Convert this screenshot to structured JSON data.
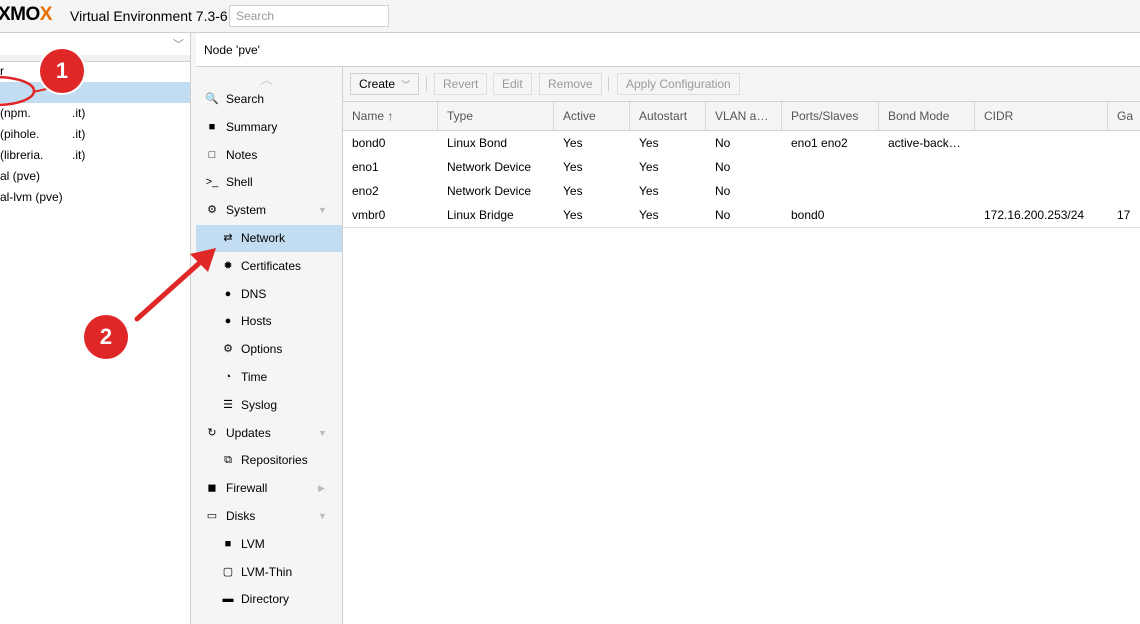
{
  "header": {
    "logo": "XMOX",
    "version": "Virtual Environment 7.3-6",
    "search_placeholder": "Search"
  },
  "tree": {
    "rows": [
      {
        "text": "r",
        "host": ""
      },
      {
        "text": "",
        "host": "",
        "selected": true
      },
      {
        "text": "(npm.",
        "host": ".it)"
      },
      {
        "text": "(pihole.",
        "host": ".it)"
      },
      {
        "text": "(libreria.",
        "host": ".it)"
      },
      {
        "text": "al (pve)",
        "host": ""
      },
      {
        "text": "al-lvm (pve)",
        "host": ""
      }
    ]
  },
  "node_title": "Node 'pve'",
  "menu": [
    {
      "label": "Search",
      "icon": "search-icon",
      "glyph": "🔍",
      "indent": false
    },
    {
      "label": "Summary",
      "icon": "book-icon",
      "glyph": "■",
      "indent": false
    },
    {
      "label": "Notes",
      "icon": "notes-icon",
      "glyph": "□",
      "indent": false
    },
    {
      "label": "Shell",
      "icon": "terminal-icon",
      "glyph": ">_",
      "indent": false
    },
    {
      "label": "System",
      "icon": "gears-icon",
      "glyph": "⚙",
      "indent": false,
      "expand": "▼"
    },
    {
      "label": "Network",
      "icon": "exchange-icon",
      "glyph": "⇄",
      "indent": true,
      "selected": true
    },
    {
      "label": "Certificates",
      "icon": "certificate-icon",
      "glyph": "✹",
      "indent": true
    },
    {
      "label": "DNS",
      "icon": "globe-icon",
      "glyph": "●",
      "indent": true
    },
    {
      "label": "Hosts",
      "icon": "globe-icon",
      "glyph": "●",
      "indent": true
    },
    {
      "label": "Options",
      "icon": "gear-icon",
      "glyph": "⚙",
      "indent": true
    },
    {
      "label": "Time",
      "icon": "clock-icon",
      "glyph": "◔",
      "indent": true
    },
    {
      "label": "Syslog",
      "icon": "list-icon",
      "glyph": "☰",
      "indent": true
    },
    {
      "label": "Updates",
      "icon": "refresh-icon",
      "glyph": "↻",
      "indent": false,
      "expand": "▼"
    },
    {
      "label": "Repositories",
      "icon": "repositories-icon",
      "glyph": "⧉",
      "indent": true
    },
    {
      "label": "Firewall",
      "icon": "shield-icon",
      "glyph": "◼",
      "indent": false,
      "expand": "▶"
    },
    {
      "label": "Disks",
      "icon": "hdd-icon",
      "glyph": "▭",
      "indent": false,
      "expand": "▼"
    },
    {
      "label": "LVM",
      "icon": "square-icon",
      "glyph": "■",
      "indent": true
    },
    {
      "label": "LVM-Thin",
      "icon": "square-outline-icon",
      "glyph": "▢",
      "indent": true
    },
    {
      "label": "Directory",
      "icon": "folder-icon",
      "glyph": "▬",
      "indent": true
    }
  ],
  "toolbar": {
    "create": "Create",
    "revert": "Revert",
    "edit": "Edit",
    "remove": "Remove",
    "apply": "Apply Configuration"
  },
  "grid": {
    "columns": [
      "Name ↑",
      "Type",
      "Active",
      "Autostart",
      "VLAN a…",
      "Ports/Slaves",
      "Bond Mode",
      "CIDR",
      "Ga"
    ],
    "rows": [
      [
        "bond0",
        "Linux Bond",
        "Yes",
        "Yes",
        "No",
        "eno1 eno2",
        "active-back…",
        "",
        ""
      ],
      [
        "eno1",
        "Network Device",
        "Yes",
        "Yes",
        "No",
        "",
        "",
        "",
        ""
      ],
      [
        "eno2",
        "Network Device",
        "Yes",
        "Yes",
        "No",
        "",
        "",
        "",
        ""
      ],
      [
        "vmbr0",
        "Linux Bridge",
        "Yes",
        "Yes",
        "No",
        "bond0",
        "",
        "172.16.200.253/24",
        "17"
      ]
    ]
  },
  "annotations": {
    "badge1": "1",
    "badge2": "2",
    "color": "#e02727"
  }
}
